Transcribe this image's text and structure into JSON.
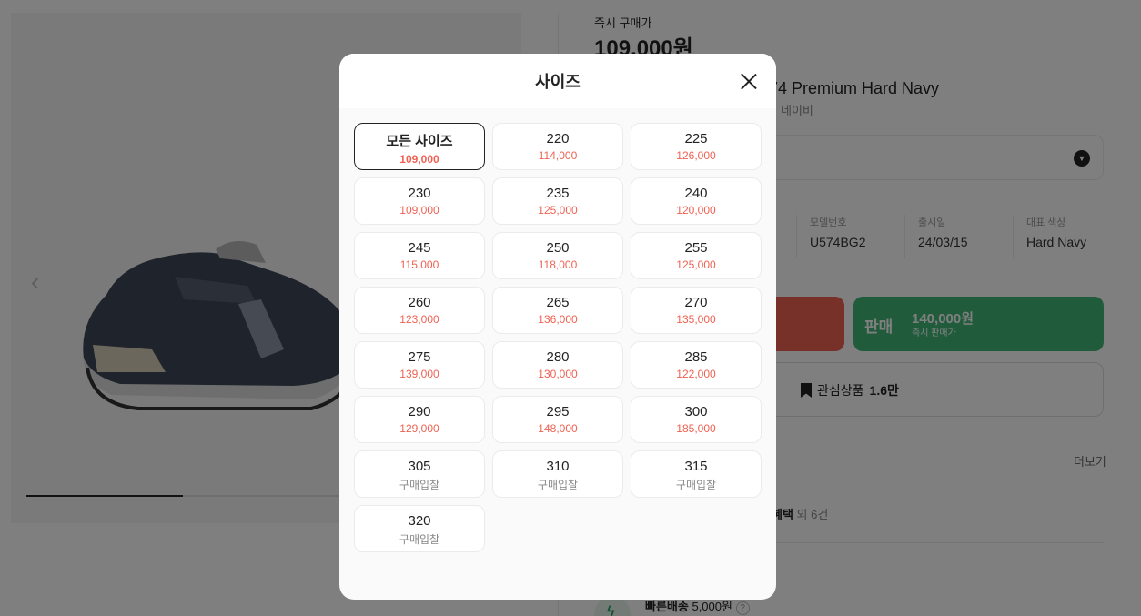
{
  "page": {
    "instant_price_label": "즉시 구매가",
    "instant_price": "109,000원",
    "product_name": "74 Premium Hard Navy",
    "product_sub": "네이비",
    "info": [
      {
        "label": "모델번호",
        "value": "U574BG2"
      },
      {
        "label": "출시일",
        "value": "24/03/15"
      },
      {
        "label": "대표 색상",
        "value": "Hard Navy"
      }
    ],
    "sell_button": {
      "label": "판매",
      "price": "140,000원",
      "sub": "즉시 판매가"
    },
    "wish_button": {
      "label": "관심상품",
      "count": "1.6만"
    },
    "more_link": "더보기",
    "benefit": {
      "text": "혜택",
      "extra": "외 6건"
    },
    "delivery": {
      "label": "빠른배송",
      "price": "5,000원",
      "help": "?"
    },
    "gallery_prev": "‹",
    "gallery_progress": 0.33
  },
  "modal": {
    "title": "사이즈",
    "sizes": [
      {
        "size": "모든 사이즈",
        "price": "109,000",
        "selected": true
      },
      {
        "size": "220",
        "price": "114,000"
      },
      {
        "size": "225",
        "price": "126,000"
      },
      {
        "size": "230",
        "price": "109,000"
      },
      {
        "size": "235",
        "price": "125,000"
      },
      {
        "size": "240",
        "price": "120,000"
      },
      {
        "size": "245",
        "price": "115,000"
      },
      {
        "size": "250",
        "price": "118,000"
      },
      {
        "size": "255",
        "price": "125,000"
      },
      {
        "size": "260",
        "price": "123,000"
      },
      {
        "size": "265",
        "price": "136,000"
      },
      {
        "size": "270",
        "price": "135,000"
      },
      {
        "size": "275",
        "price": "139,000"
      },
      {
        "size": "280",
        "price": "130,000"
      },
      {
        "size": "285",
        "price": "122,000"
      },
      {
        "size": "290",
        "price": "129,000"
      },
      {
        "size": "295",
        "price": "148,000"
      },
      {
        "size": "300",
        "price": "185,000"
      },
      {
        "size": "305",
        "price": "구매입찰",
        "bid": true
      },
      {
        "size": "310",
        "price": "구매입찰",
        "bid": true
      },
      {
        "size": "315",
        "price": "구매입찰",
        "bid": true
      },
      {
        "size": "320",
        "price": "구매입찰",
        "bid": true
      }
    ]
  },
  "colors": {
    "price_red": "#ef6253",
    "sell_green": "#41b979",
    "buy_red": "#ef6253"
  }
}
